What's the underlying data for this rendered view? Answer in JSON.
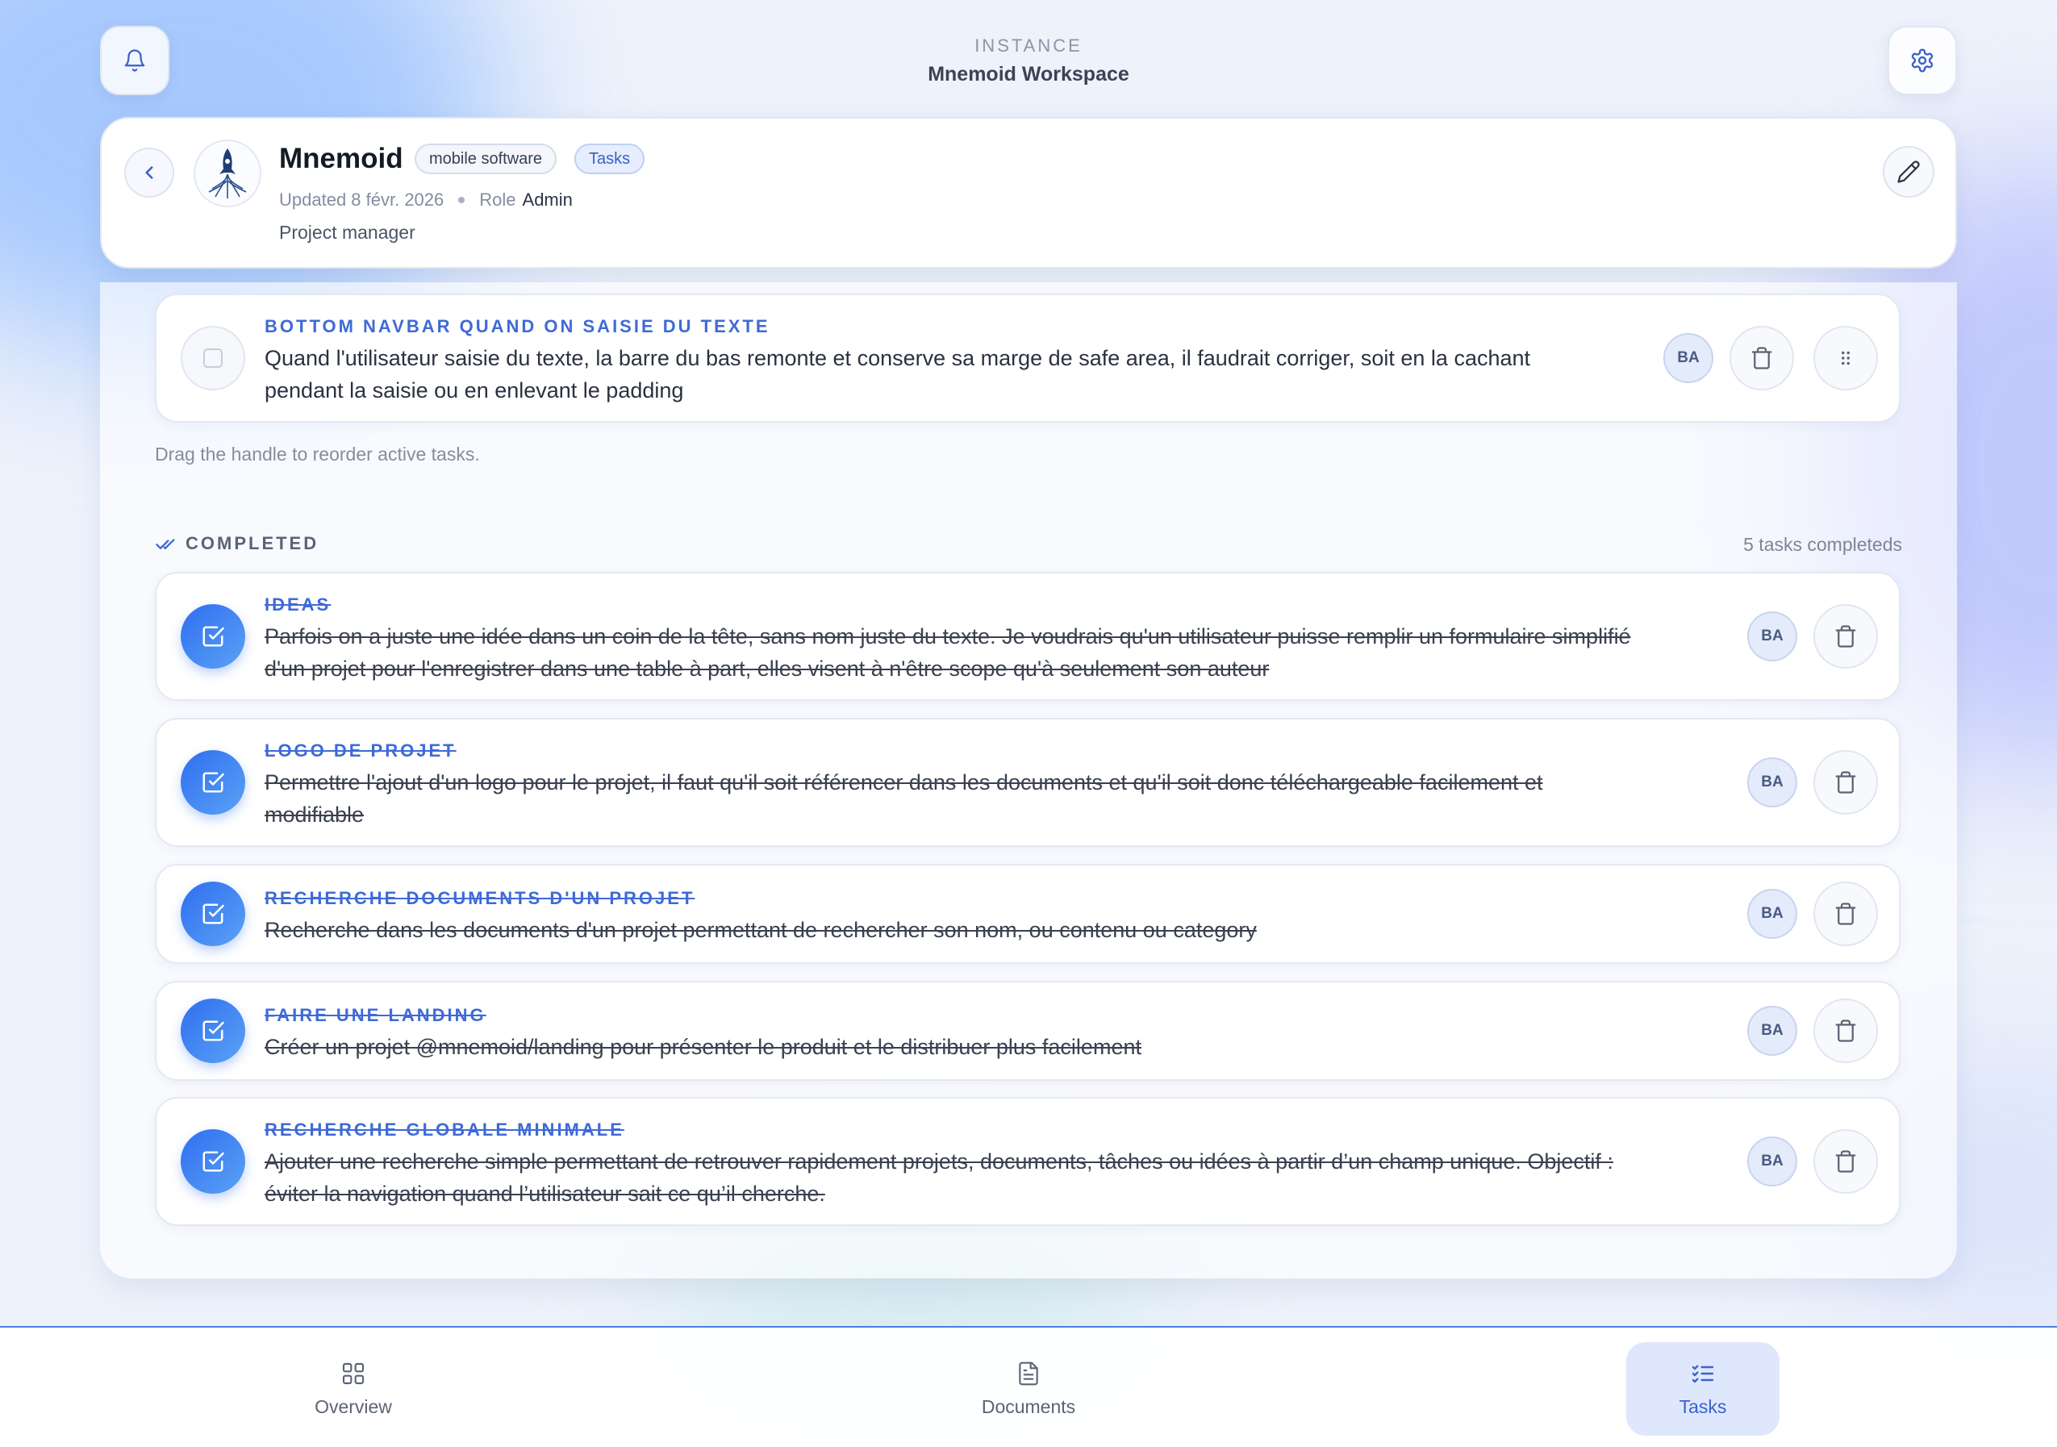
{
  "instance": {
    "label": "INSTANCE",
    "name": "Mnemoid Workspace"
  },
  "project": {
    "name": "Mnemoid",
    "category_chip": "mobile software",
    "section_chip": "Tasks",
    "updated": "Updated 8 févr. 2026",
    "role_label": "Role",
    "role_value": "Admin",
    "role_subtitle": "Project manager"
  },
  "active_tasks": [
    {
      "title": "BOTTOM NAVBAR QUAND ON SAISIE DU TEXTE",
      "description_line1": "Quand l'utilisateur saisie du texte, la barre du bas remonte et conserve sa marge de safe area, il faudrait corriger, soit en la cachant",
      "description_line2": "pendant la saisie ou en enlevant le padding",
      "assignee": "BA"
    }
  ],
  "hint": "Drag the handle to reorder active tasks.",
  "completed": {
    "label": "COMPLETED",
    "count_text": "5 tasks completeds",
    "items": [
      {
        "title": "IDEAS",
        "description_line1": "Parfois on a juste une idée dans un coin de la tête, sans nom juste du texte. Je voudrais qu'un utilisateur puisse remplir un formulaire simplifié",
        "description_line2": "d'un projet pour l'enregistrer dans une table à part, elles visent à n'être scope qu'à seulement son auteur",
        "assignee": "BA"
      },
      {
        "title": "LOGO DE PROJET",
        "description_line1": "Permettre l'ajout d'un logo pour le projet, il faut qu'il soit référencer dans les documents et qu'il soit donc téléchargeable facilement et",
        "description_line2": "modifiable",
        "assignee": "BA"
      },
      {
        "title": "RECHERCHE DOCUMENTS D'UN PROJET",
        "description_line1": "Recherche dans les documents d'un projet permettant de rechercher son nom, ou contenu ou category",
        "description_line2": "",
        "assignee": "BA"
      },
      {
        "title": "FAIRE UNE LANDING",
        "description_line1": "Créer un projet @mnemoid/landing pour présenter le produit et le distribuer plus facilement",
        "description_line2": "",
        "assignee": "BA"
      },
      {
        "title": "RECHERCHE GLOBALE MINIMALE",
        "description_line1": "Ajouter une recherche simple permettant de retrouver rapidement projets, documents, tâches ou idées à partir d’un champ unique. Objectif :",
        "description_line2": "éviter la navigation quand l’utilisateur sait ce qu’il cherche.",
        "assignee": "BA"
      }
    ]
  },
  "bottom_nav": {
    "overview": "Overview",
    "documents": "Documents",
    "tasks": "Tasks",
    "active": "tasks"
  },
  "colors": {
    "accent": "#3e6ad8",
    "check_gradient_start": "#2f6ef0",
    "check_gradient_end": "#5aa2f5",
    "active_nav_bg": "#dfe7fd"
  },
  "icons": {
    "bell": "bell-icon",
    "gear": "gear-icon",
    "back": "chevron-left-icon",
    "edit": "pencil-icon",
    "trash": "trash-icon",
    "drag": "drag-handle-icon",
    "check": "checkbox-checked-icon",
    "double_check": "double-check-icon",
    "overview": "grid-icon",
    "documents": "document-icon",
    "tasks": "tasks-list-icon"
  }
}
